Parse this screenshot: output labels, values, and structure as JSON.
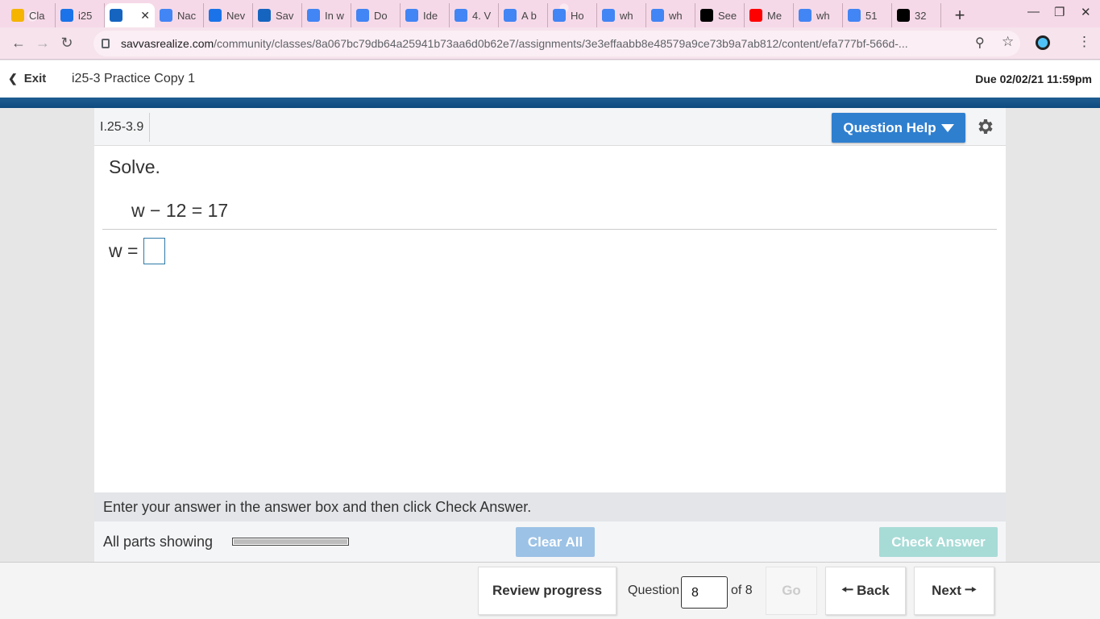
{
  "browser": {
    "tabs": [
      {
        "title": "Cla",
        "icon": "classroom-icon",
        "color": "#f4b400"
      },
      {
        "title": "i25",
        "icon": "contacts-icon",
        "color": "#1a73e8"
      },
      {
        "title": "",
        "icon": "savvas-icon",
        "color": "#1565c0",
        "active": true
      },
      {
        "title": "Nac",
        "icon": "docs-icon",
        "color": "#4285f4"
      },
      {
        "title": "Nev",
        "icon": "newsela-icon",
        "color": "#1a73e8"
      },
      {
        "title": "Sav",
        "icon": "savvas-icon",
        "color": "#1565c0"
      },
      {
        "title": "In w",
        "icon": "google-icon",
        "color": "#4285f4"
      },
      {
        "title": "Do",
        "icon": "google-icon",
        "color": "#4285f4"
      },
      {
        "title": "Ide",
        "icon": "google-icon",
        "color": "#4285f4"
      },
      {
        "title": "4. V",
        "icon": "google-icon",
        "color": "#4285f4"
      },
      {
        "title": "A b",
        "icon": "google-icon",
        "color": "#4285f4"
      },
      {
        "title": "Ho",
        "icon": "google-icon",
        "color": "#4285f4"
      },
      {
        "title": "wh",
        "icon": "google-icon",
        "color": "#4285f4"
      },
      {
        "title": "wh",
        "icon": "google-icon",
        "color": "#4285f4"
      },
      {
        "title": "See",
        "icon": "nytimes-icon",
        "color": "#000000"
      },
      {
        "title": "Me",
        "icon": "youtube-icon",
        "color": "#ff0000"
      },
      {
        "title": "wh",
        "icon": "google-icon",
        "color": "#4285f4"
      },
      {
        "title": "51",
        "icon": "google-icon",
        "color": "#4285f4"
      },
      {
        "title": "32",
        "icon": "brainly-icon",
        "color": "#000000"
      }
    ],
    "url_host": "savvasrealize.com",
    "url_path": "/community/classes/8a067bc79db64a25941b73aa6d0b62e7/assignments/3e3effaabb8e48579a9ce73b9a7ab812/content/efa777bf-566d-..."
  },
  "header": {
    "exit_label": "Exit",
    "assignment_title": "i25-3 Practice Copy 1",
    "due": "Due 02/02/21 11:59pm"
  },
  "question": {
    "id": "I.25-3.9",
    "help_label": "Question Help",
    "prompt": "Solve.",
    "equation": "w − 12 = 17",
    "answer_label": "w =",
    "answer_value": "",
    "instruction": "Enter your answer in the answer box and then click Check Answer.",
    "parts_label": "All parts showing",
    "progress": 1.0,
    "clear_all_label": "Clear All",
    "check_answer_label": "Check Answer"
  },
  "nav": {
    "review_label": "Review progress",
    "question_label": "Question",
    "question_number": "8",
    "of_label": "of 8",
    "go_label": "Go",
    "back_label": "Back",
    "next_label": "Next"
  },
  "colors": {
    "accent": "#2f7fcf",
    "header_bar": "#0e4a7e",
    "check_disabled": "#a7dbd6",
    "clear_disabled": "#9cc2e6"
  }
}
